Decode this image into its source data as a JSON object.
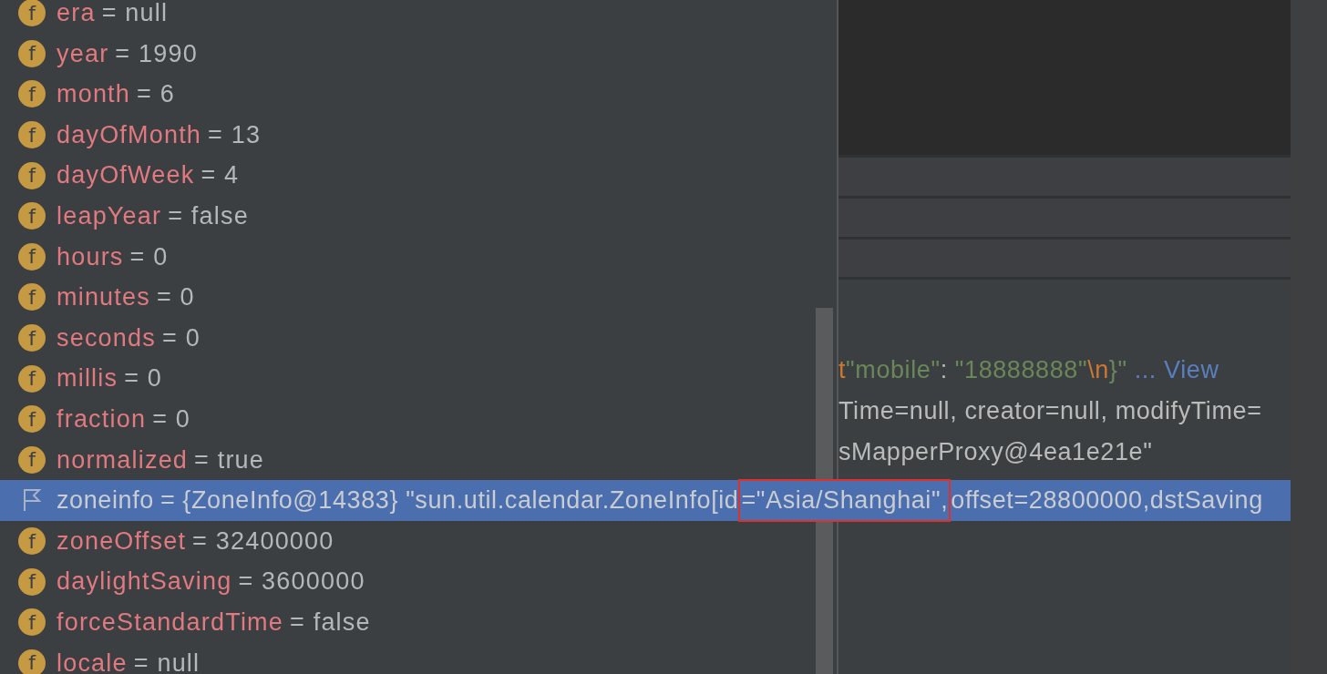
{
  "variables": [
    {
      "kind": "field",
      "icon_text": "f",
      "name": "era",
      "value": "= null",
      "selected": false
    },
    {
      "kind": "field",
      "icon_text": "f",
      "name": "year",
      "value": "= 1990",
      "selected": false
    },
    {
      "kind": "field",
      "icon_text": "f",
      "name": "month",
      "value": "= 6",
      "selected": false
    },
    {
      "kind": "field",
      "icon_text": "f",
      "name": "dayOfMonth",
      "value": "= 13",
      "selected": false
    },
    {
      "kind": "field",
      "icon_text": "f",
      "name": "dayOfWeek",
      "value": "= 4",
      "selected": false
    },
    {
      "kind": "field",
      "icon_text": "f",
      "name": "leapYear",
      "value": "= false",
      "selected": false
    },
    {
      "kind": "field",
      "icon_text": "f",
      "name": "hours",
      "value": "= 0",
      "selected": false
    },
    {
      "kind": "field",
      "icon_text": "f",
      "name": "minutes",
      "value": "= 0",
      "selected": false
    },
    {
      "kind": "field",
      "icon_text": "f",
      "name": "seconds",
      "value": "= 0",
      "selected": false
    },
    {
      "kind": "field",
      "icon_text": "f",
      "name": "millis",
      "value": "= 0",
      "selected": false
    },
    {
      "kind": "field",
      "icon_text": "f",
      "name": "fraction",
      "value": "= 0",
      "selected": false
    },
    {
      "kind": "field",
      "icon_text": "f",
      "name": "normalized",
      "value": "= true",
      "selected": false
    },
    {
      "kind": "marked",
      "name": "zoneinfo",
      "value_parts": [
        {
          "text": "= {ZoneInfo@14383} \"sun.util.calendar.ZoneInfo[id",
          "annotated": false
        },
        {
          "text": "=\"Asia/Shanghai\",",
          "annotated": true
        },
        {
          "text": "offset=28800000,dstSaving",
          "annotated": false
        }
      ],
      "selected": true
    },
    {
      "kind": "field",
      "icon_text": "f",
      "name": "zoneOffset",
      "value": "= 32400000",
      "selected": false
    },
    {
      "kind": "field",
      "icon_text": "f",
      "name": "daylightSaving",
      "value": "= 3600000",
      "selected": false
    },
    {
      "kind": "field",
      "icon_text": "f",
      "name": "forceStandardTime",
      "value": "= false",
      "selected": false
    },
    {
      "kind": "field",
      "icon_text": "f",
      "name": "locale",
      "value": "= null",
      "selected": false
    }
  ],
  "right_pane": {
    "lines": [
      {
        "segments": [
          {
            "kind": "escape",
            "text": "t"
          },
          {
            "kind": "string",
            "text": "\"mobile\""
          },
          {
            "kind": "plain",
            "text": ": "
          },
          {
            "kind": "string",
            "text": "\"18888888\""
          },
          {
            "kind": "escape",
            "text": "\\n"
          },
          {
            "kind": "string",
            "text": "}\""
          }
        ],
        "link": "... View"
      },
      {
        "segments": [
          {
            "kind": "plain",
            "text": "Time=null, creator=null, modifyTime="
          }
        ]
      },
      {
        "segments": [
          {
            "kind": "plain",
            "text": "sMapperProxy@4ea1e21e\""
          }
        ]
      }
    ]
  }
}
